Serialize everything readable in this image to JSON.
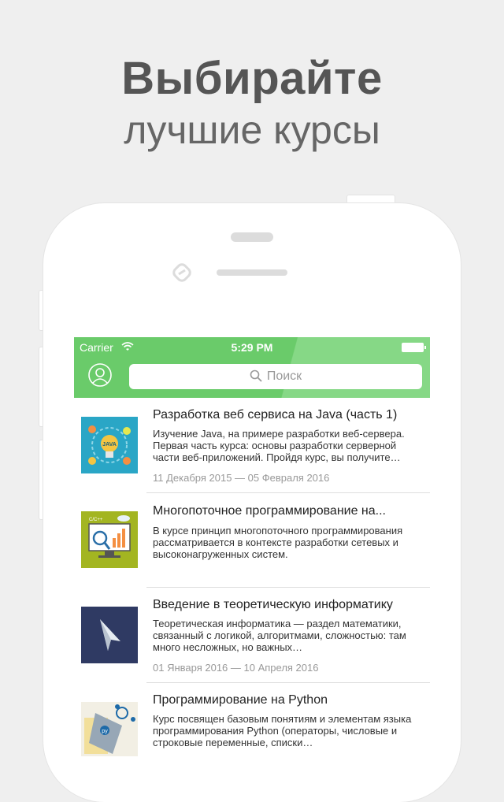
{
  "promo": {
    "headline": "Выбирайте",
    "subheadline": "лучшие курсы"
  },
  "status_bar": {
    "carrier": "Carrier",
    "time": "5:29 PM"
  },
  "header": {
    "search_placeholder": "Поиск",
    "colors": {
      "accent": "#6acb6a",
      "accent_light": "#86d886"
    }
  },
  "courses": [
    {
      "title": "Разработка веб сервиса на Java (часть 1)",
      "description": "Изучение Java, на примере разработки веб-сервера. Первая часть курса: основы разработки серверной части веб-приложений. Пройдя курс, вы получите…",
      "dates": "11 Декабря 2015 — 05 Февраля 2016",
      "icon": "java-lightbulb-icon"
    },
    {
      "title": "Многопоточное программирование на...",
      "description": "В курсе принцип многопоточного программирования рассматривается в контексте разработки сетевых и высоконагруженных систем.",
      "dates": "",
      "icon": "monitor-analytics-icon"
    },
    {
      "title": "Введение в теоретическую информатику",
      "description": "Теоретическая информатика — раздел математики, связанный с логикой, алгоритмами, сложностью: там много несложных, но важных…",
      "dates": "01 Января 2016 — 10 Апреля 2016",
      "icon": "paper-plane-icon"
    },
    {
      "title": "Программирование на Python",
      "description": "Курс посвящен базовым понятиям и элементам языка программирования Python (операторы, числовые и строковые переменные, списки…",
      "dates": "",
      "icon": "python-tag-icon"
    }
  ]
}
